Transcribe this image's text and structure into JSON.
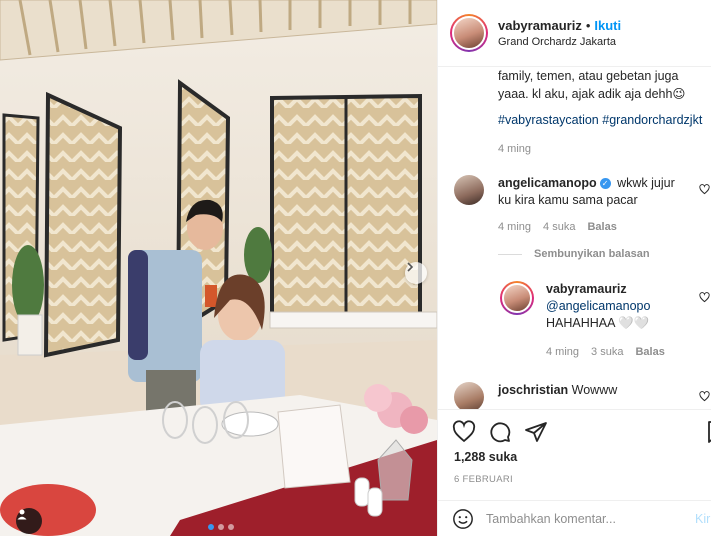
{
  "post": {
    "username": "vabyramauriz",
    "separator": "•",
    "follow_label": "Ikuti",
    "location": "Grand Orchardz Jakarta"
  },
  "caption": {
    "text": "family, temen, atau gebetan juga yaaa. kl aku, ajak adik aja dehh😉",
    "hashtags": [
      "#vabyrastaycation",
      "#grandorchardzjkt"
    ],
    "time": "4 ming"
  },
  "comments": [
    {
      "username": "angelicamanopo",
      "verified": true,
      "text": "wkwk jujur ku kira kamu sama pacar",
      "time": "4 ming",
      "likes": "4 suka",
      "reply_label": "Balas"
    }
  ],
  "hide_replies_label": "Sembunyikan balasan",
  "reply": {
    "username": "vabyramauriz",
    "mention": "@angelicamanopo",
    "text": "HAHAHHAA 🤍🤍",
    "time": "4 ming",
    "likes": "3 suka",
    "reply_label": "Balas"
  },
  "comment3": {
    "username": "joschristian",
    "text": "Wowww"
  },
  "likes_count": "1,288 suka",
  "post_date": "6 FEBRUARI",
  "comment_input": {
    "placeholder": "Tambahkan komentar...",
    "post_label": "Kir"
  },
  "carousel": {
    "slides": 3,
    "active_slide": 1
  },
  "colors": {
    "accent": "#0095f6",
    "link": "#00376b",
    "muted": "#8e8e8e",
    "carousel_dot": "#3897f0"
  }
}
